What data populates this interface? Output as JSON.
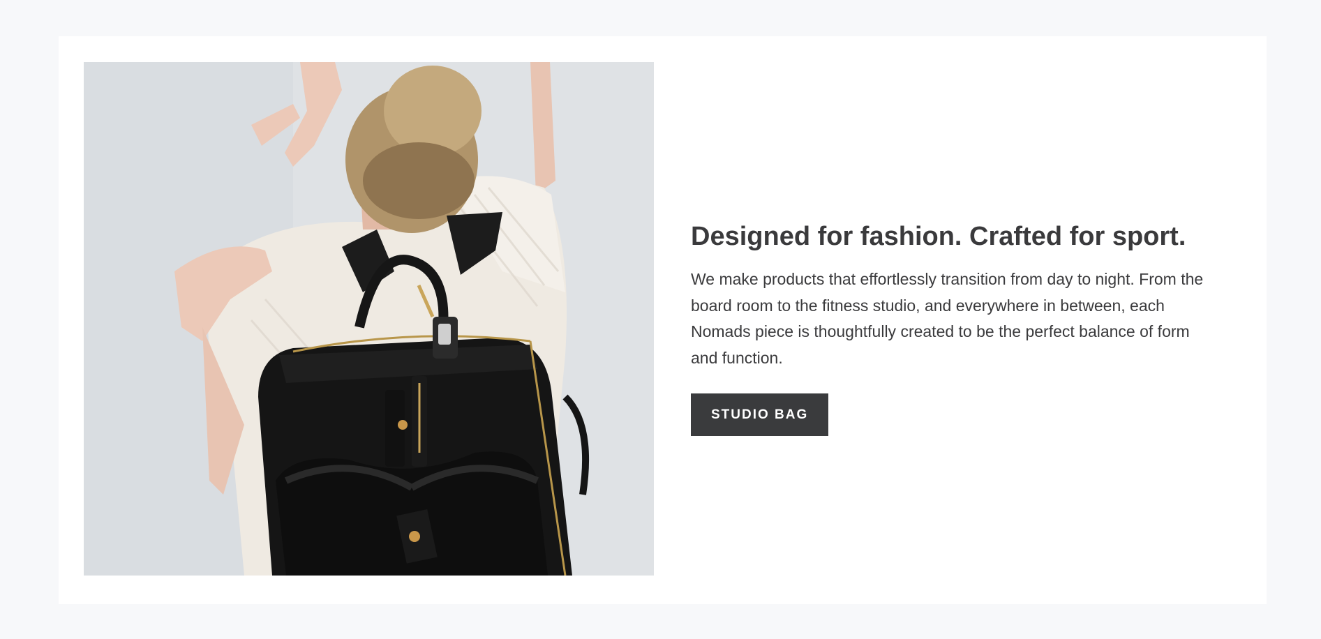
{
  "feature": {
    "image_alt": "Woman wearing a black backpack",
    "headline": "Designed for fashion. Crafted for sport.",
    "body": "We make products that effortlessly transition from day to night. From the board room to the fitness studio, and everywhere in between, each Nomads piece is thoughtfully created to be the perfect balance of form and function.",
    "button_label": "STUDIO BAG"
  },
  "colors": {
    "page_background": "#f7f8fa",
    "card_background": "#ffffff",
    "text": "#3a3a3c",
    "button_background": "#3a3b3d",
    "button_text": "#ffffff"
  }
}
